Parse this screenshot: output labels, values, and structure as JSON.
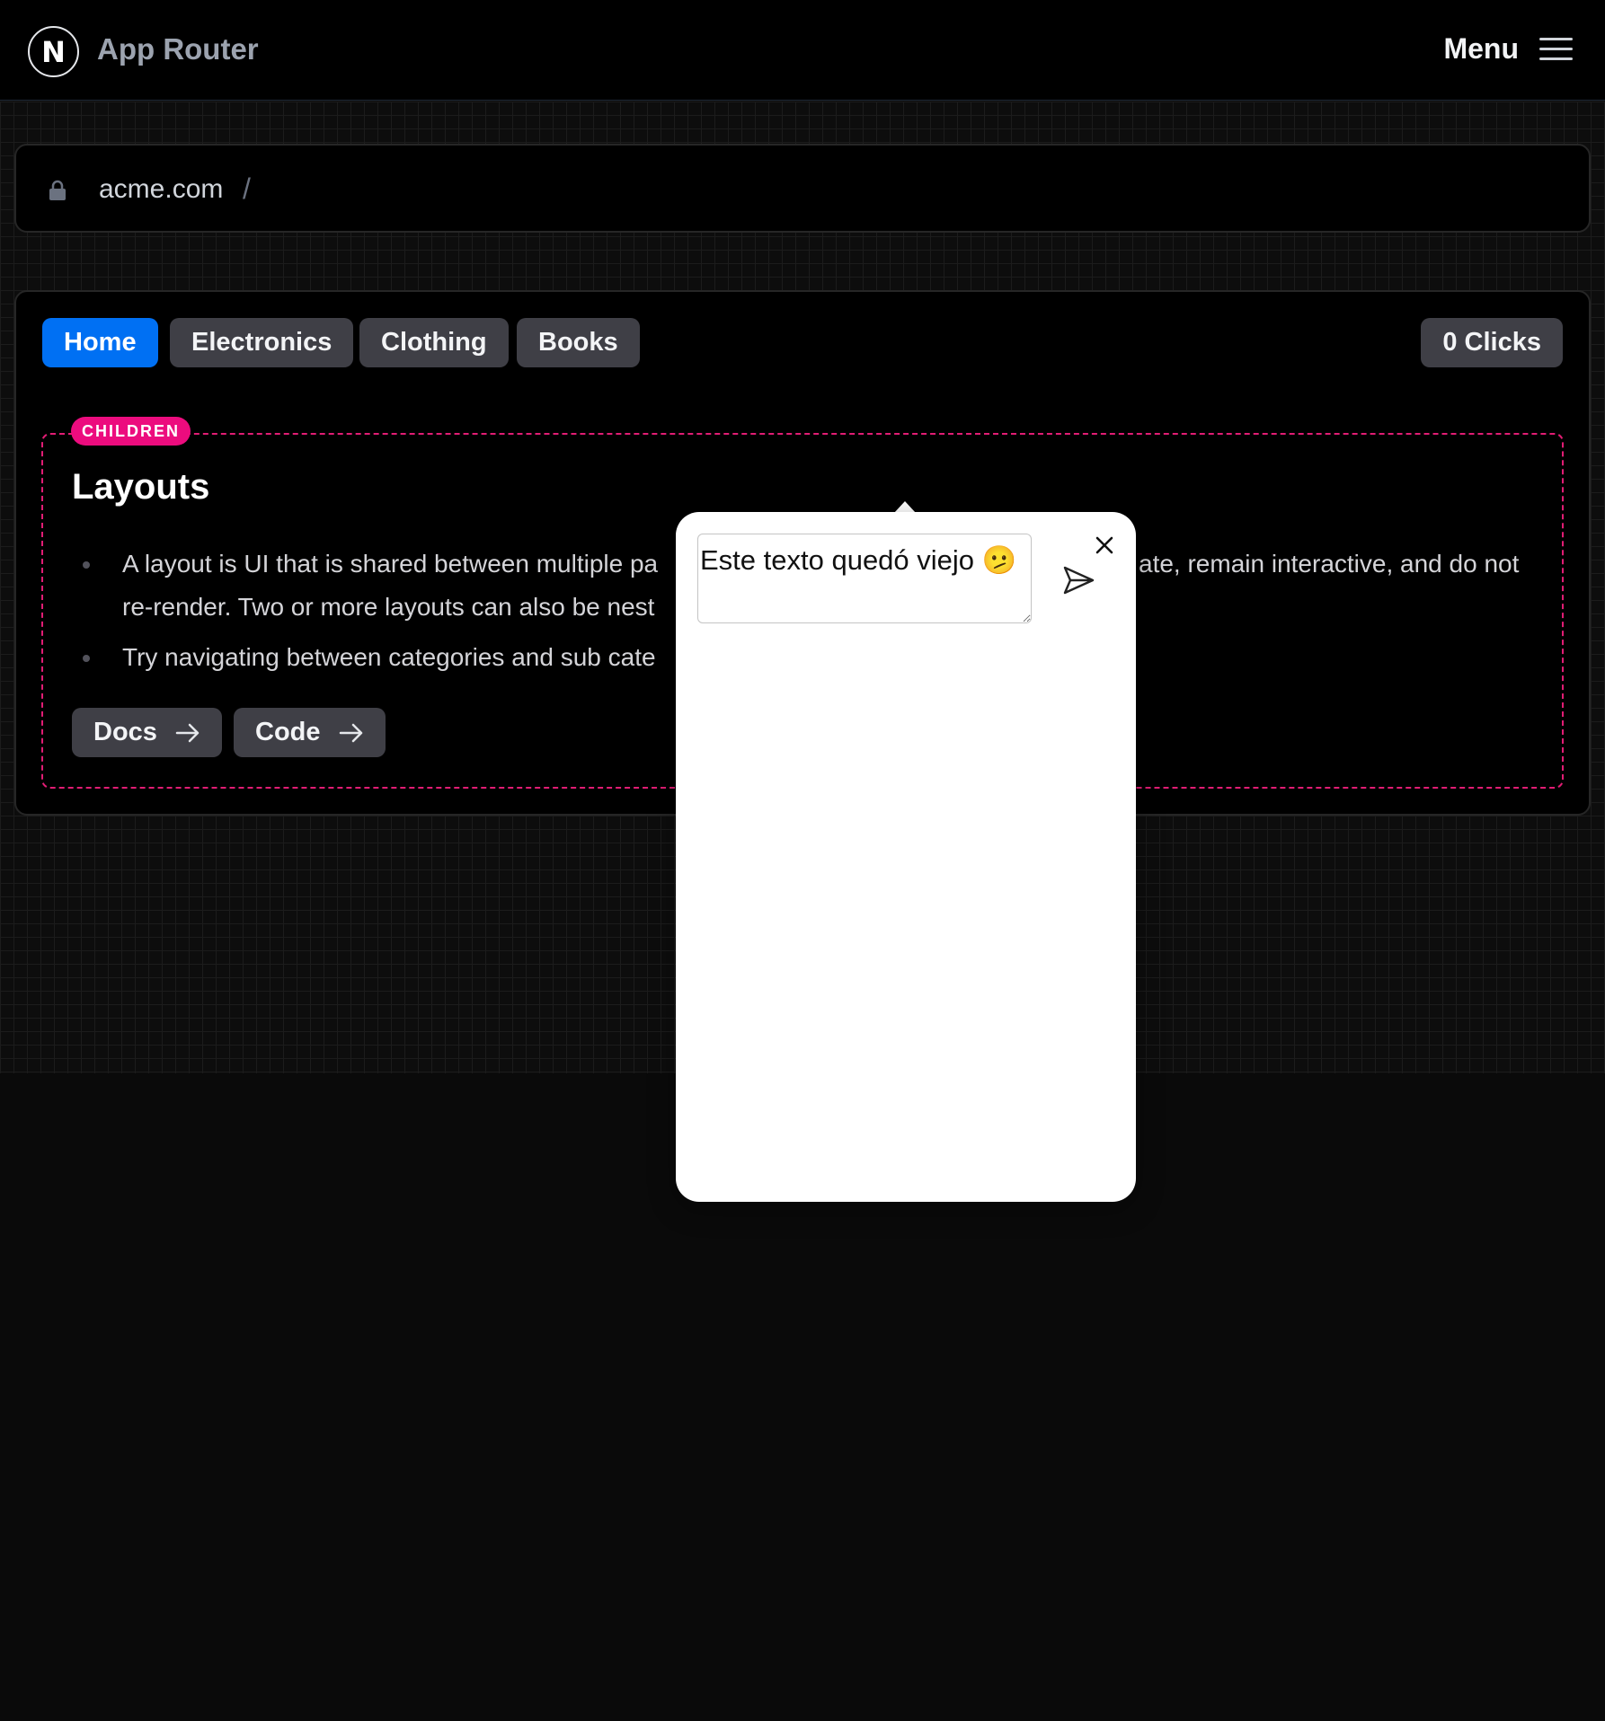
{
  "header": {
    "logo_letter": "N",
    "title": "App Router",
    "menu_label": "Menu"
  },
  "urlbar": {
    "domain": "acme.com",
    "separator": "/"
  },
  "nav": {
    "tabs": [
      {
        "label": "Home",
        "active": true
      },
      {
        "label": "Electronics",
        "active": false
      },
      {
        "label": "Clothing",
        "active": false
      },
      {
        "label": "Books",
        "active": false
      }
    ],
    "clicks_label": "0 Clicks"
  },
  "content": {
    "badge": "CHILDREN",
    "title": "Layouts",
    "bullets": [
      "A layout is UI that is shared between multiple pa",
      "ate, remain interactive, and do not",
      "re-render. Two or more layouts can also be nest",
      "Try navigating between categories and sub cate"
    ],
    "links": [
      {
        "label": "Docs"
      },
      {
        "label": "Code"
      }
    ]
  },
  "popup": {
    "textarea_value": "Este texto quedó viejo 🫤"
  },
  "colors": {
    "accent": "#0070f3",
    "badge": "#ec0c7e",
    "dashed_border": "#e11d74",
    "button_bg": "#3f3f46"
  }
}
